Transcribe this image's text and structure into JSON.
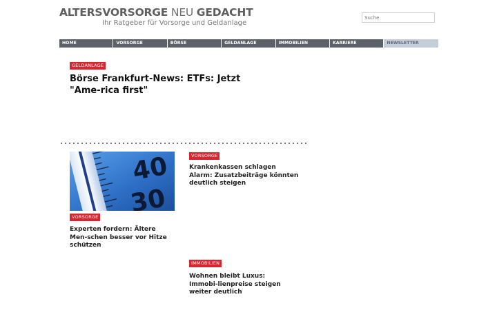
{
  "brand": {
    "part1": "ALTERSVORSORGE",
    "part2": " NEU ",
    "part3": "GEDACHT",
    "subtitle": "Ihr Ratgeber für Vorsorge und Geldanlage"
  },
  "search": {
    "placeholder": "Suche",
    "value": ""
  },
  "nav": {
    "items": [
      "HOME",
      "VORSORGE",
      "BÖRSE",
      "GELDANLAGE",
      "IMMOBILIEN",
      "KARRIERE"
    ],
    "newsletter": "NEWSLETTER"
  },
  "lead": {
    "tag": "GELDANLAGE",
    "title": "Börse Frankfurt-News: ETFs: Jetzt \"Ame-rica first\""
  },
  "articles": [
    {
      "tag": "VORSORGE",
      "title": "Experten fordern: Ältere Men-schen besser vor Hitze schützen",
      "image": "thermometer-image"
    },
    {
      "tag": "VORSORGE",
      "title": "Krankenkassen schlagen Alarm: Zusatzbeiträge könnten deutlich steigen"
    },
    {
      "tag": "IMMOBILIEN",
      "title": "Wohnen bleibt Luxus: Immobi-lienpreise steigen weiter deutlich"
    }
  ],
  "thumbnail": {
    "digits_top": "40",
    "digits_bottom": "30"
  },
  "colors": {
    "tag_red": "#d7262f",
    "nav_gray": "#5b6166",
    "newsletter_bg": "#c3ced8",
    "thumb_blue": "#3f7fd0"
  }
}
